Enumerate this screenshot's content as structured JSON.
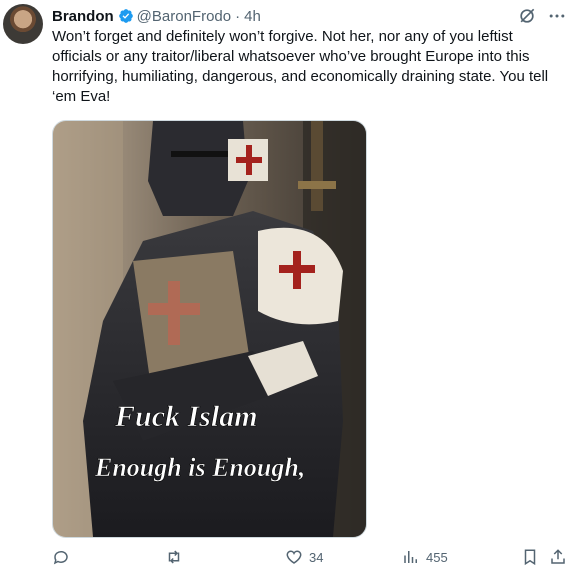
{
  "tweet": {
    "author_name": "Brandon",
    "handle": "@BaronFrodo",
    "separator": "·",
    "time": "4h",
    "text": "Won’t forget and definitely won’t forgive. Not her, nor any of you leftist officials or any traitor/liberal whatsoever who’ve brought Europe into this horrifying, humiliating, dangerous, and economically draining state.  You tell ‘em Eva!",
    "media_caption_line1": "Fuck Islam",
    "media_caption_line2": "Enough is Enough,"
  },
  "actions": {
    "reply_count": "",
    "retweet_count": "",
    "like_count": "34",
    "views_count": "455"
  },
  "icons": {
    "verified": "verified-badge-icon",
    "grok": "grok-icon",
    "more": "more-icon",
    "reply": "reply-icon",
    "retweet": "retweet-icon",
    "like": "heart-icon",
    "views": "views-icon",
    "bookmark": "bookmark-icon",
    "share": "share-icon"
  },
  "colors": {
    "accent": "#1d9bf0",
    "secondary_text": "#536471",
    "primary_text": "#0f1419"
  }
}
